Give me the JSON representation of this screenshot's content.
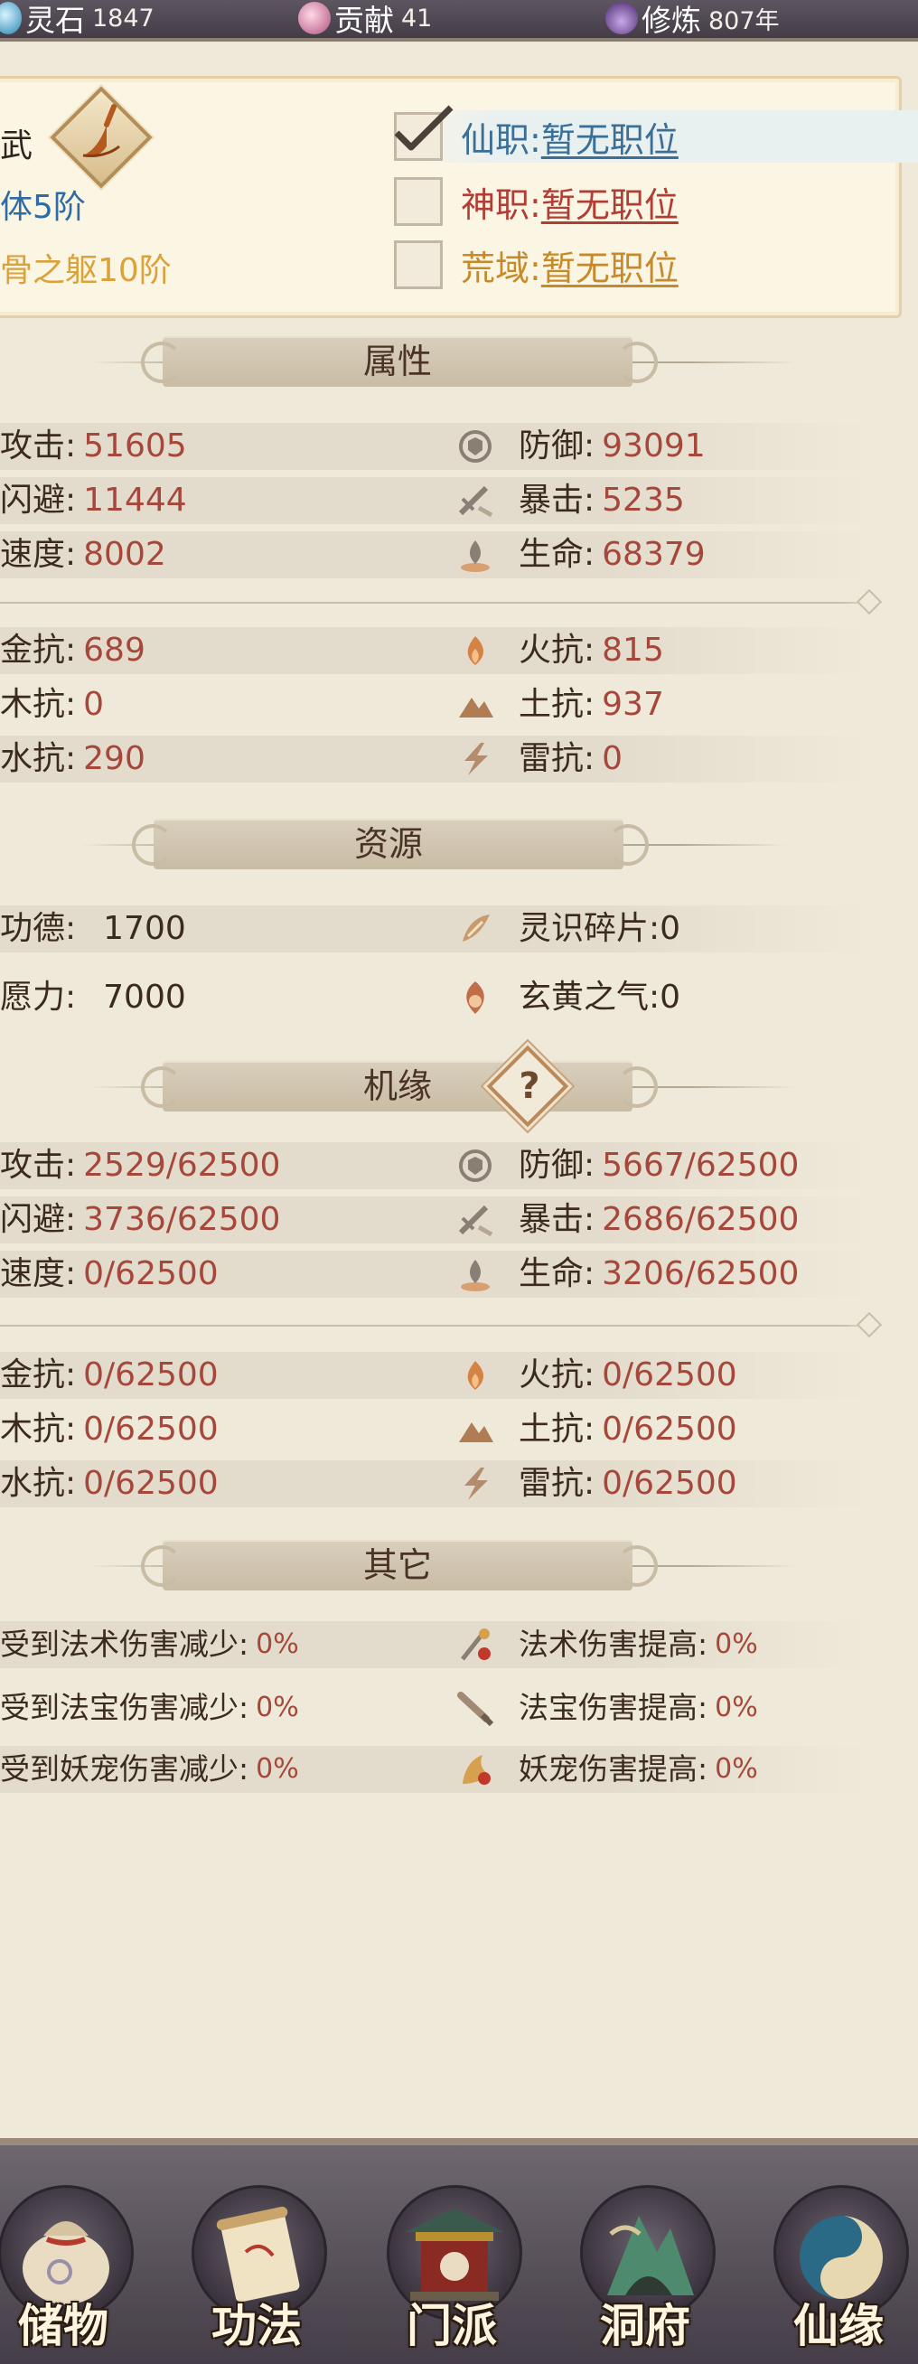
{
  "topbar": {
    "spirit_stone_label": "灵石",
    "spirit_stone_value": "1847",
    "contribution_label": "贡献",
    "contribution_value": "41",
    "cultivation_label": "修炼",
    "cultivation_value": "807年"
  },
  "header": {
    "left_line1": "武",
    "left_line2": "体5阶",
    "left_line3": "骨之躯10阶",
    "jobs": [
      {
        "label": "仙职:",
        "value": "暂无职位",
        "checked": true
      },
      {
        "label": "神职:",
        "value": "暂无职位",
        "checked": false
      },
      {
        "label": "荒域:",
        "value": "暂无职位",
        "checked": false
      }
    ]
  },
  "attributes": {
    "title": "属性",
    "rows": [
      {
        "l_key": "攻击:",
        "l_val": "51605",
        "r_key": "防御:",
        "r_val": "93091",
        "r_icon": "shield-icon"
      },
      {
        "l_key": "闪避:",
        "l_val": "11444",
        "r_key": "暴击:",
        "r_val": "5235",
        "r_icon": "crit-sword-icon"
      },
      {
        "l_key": "速度:",
        "l_val": "8002",
        "r_key": "生命:",
        "r_val": "68379",
        "r_icon": "life-flame-icon"
      },
      {
        "l_key": "金抗:",
        "l_val": "689",
        "r_key": "火抗:",
        "r_val": "815",
        "r_icon": "fire-icon"
      },
      {
        "l_key": "木抗:",
        "l_val": "0",
        "r_key": "土抗:",
        "r_val": "937",
        "r_icon": "mountain-icon"
      },
      {
        "l_key": "水抗:",
        "l_val": "290",
        "r_key": "雷抗:",
        "r_val": "0",
        "r_icon": "lightning-icon"
      }
    ]
  },
  "resources": {
    "title": "资源",
    "rows": [
      {
        "l_key": "功德:",
        "l_val": "1700",
        "r_key": "灵识碎片:",
        "r_val": "0",
        "r_icon": "spirit-shard-icon"
      },
      {
        "l_key": "愿力:",
        "l_val": "7000",
        "r_key": "玄黄之气:",
        "r_val": "0",
        "r_icon": "xuanhuang-qi-icon"
      }
    ]
  },
  "fortune": {
    "title": "机缘",
    "help": "?",
    "rows": [
      {
        "l_key": "攻击:",
        "l_val": "2529/62500",
        "r_key": "防御:",
        "r_val": "5667/62500",
        "r_icon": "shield-icon"
      },
      {
        "l_key": "闪避:",
        "l_val": "3736/62500",
        "r_key": "暴击:",
        "r_val": "2686/62500",
        "r_icon": "crit-sword-icon"
      },
      {
        "l_key": "速度:",
        "l_val": "0/62500",
        "r_key": "生命:",
        "r_val": "3206/62500",
        "r_icon": "life-flame-icon"
      },
      {
        "l_key": "金抗:",
        "l_val": "0/62500",
        "r_key": "火抗:",
        "r_val": "0/62500",
        "r_icon": "fire-icon"
      },
      {
        "l_key": "木抗:",
        "l_val": "0/62500",
        "r_key": "土抗:",
        "r_val": "0/62500",
        "r_icon": "mountain-icon"
      },
      {
        "l_key": "水抗:",
        "l_val": "0/62500",
        "r_key": "雷抗:",
        "r_val": "0/62500",
        "r_icon": "lightning-icon"
      }
    ]
  },
  "other": {
    "title": "其它",
    "rows": [
      {
        "l_key": "受到法术伤害减少:",
        "l_val": "0%",
        "r_key": "法术伤害提高:",
        "r_val": "0%",
        "r_icon": "spell-icon"
      },
      {
        "l_key": "受到法宝伤害减少:",
        "l_val": "0%",
        "r_key": "法宝伤害提高:",
        "r_val": "0%",
        "r_icon": "treasure-icon"
      },
      {
        "l_key": "受到妖宠伤害减少:",
        "l_val": "0%",
        "r_key": "妖宠伤害提高:",
        "r_val": "0%",
        "r_icon": "pet-icon"
      }
    ]
  },
  "nav": [
    {
      "label": "储物",
      "icon": "storage-bag-icon"
    },
    {
      "label": "功法",
      "icon": "scroll-icon"
    },
    {
      "label": "门派",
      "icon": "sect-gate-icon"
    },
    {
      "label": "洞府",
      "icon": "cave-mountain-icon"
    },
    {
      "label": "仙缘",
      "icon": "yin-yang-icon"
    }
  ],
  "colors": {
    "value_red": "#a6473b",
    "background": "#efe9d9",
    "row_stripe": "#e3dccd",
    "job_blue": "#3b6f98",
    "job_gold": "#c68a2a"
  }
}
